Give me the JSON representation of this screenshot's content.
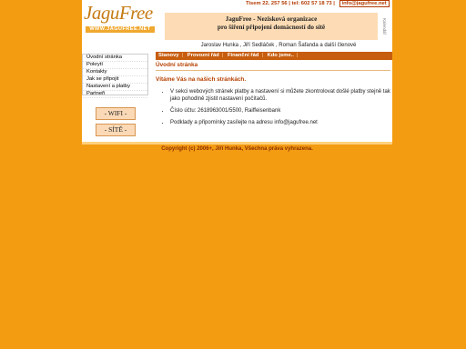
{
  "logo": {
    "text": "JaguFree",
    "url_text": "WWW.JAGUFREE.NET"
  },
  "contact": {
    "phone": "Tisem 22. 257 56 | tel: 602 57 18 73 |",
    "email": "info@jagufree.net"
  },
  "banner": {
    "line1": "JaguFree - Nezisková organizace",
    "line2": "pro šíření připojení domácností do sítě"
  },
  "banner_side": "Kalendář",
  "members": "Jaroslav Hunka , Jiří Sedláček , Roman Šafanda a další členové",
  "topnav": [
    "Stanovy",
    "Provozní řád",
    "Finanční řád",
    "Kdo jsme.."
  ],
  "leftnav": [
    "Úvodní stránka",
    "Pokrytí",
    "Kontakty",
    "Jak se připojit",
    "Nastavení a platby",
    "Partneři"
  ],
  "sidebuttons": [
    "- WIFI -",
    "- SÍTĚ -"
  ],
  "content": {
    "title": "Úvodní stránka",
    "welcome": "Vítáme Vás na našich stránkách.",
    "items": [
      "V sekci webových stránek platby a nastavení si můžete zkontrolovat došlé platby stejně tak jako pohodlně zjistit nastavení počítačů.",
      "Číslo účtu: 2618963001/5500, Raiffeisenbank",
      "Podklady a připomínky zasílejte na adresu info@jagufree.net"
    ]
  },
  "footer": "Copyright (c) 2006+, Jiří Hunka, Všechna práva vyhrazena."
}
